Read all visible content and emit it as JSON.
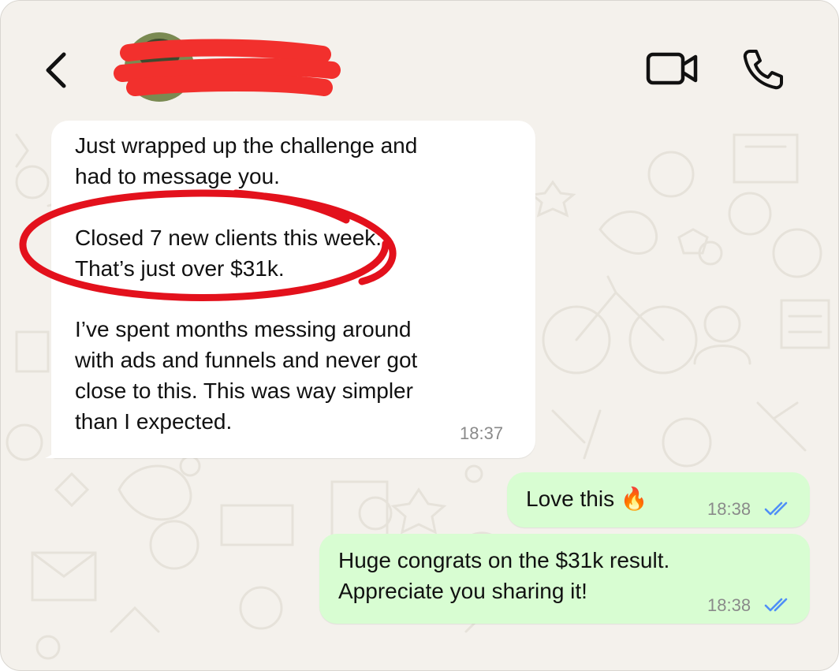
{
  "header": {
    "contact_name": "",
    "icons": {
      "back": "chevron-left-icon",
      "video": "video-camera-icon",
      "call": "phone-icon"
    }
  },
  "messages": {
    "incoming": {
      "p1": "Just wrapped up the challenge and\nhad to message you.",
      "p2": "Closed 7 new clients this week.\nThat’s just over $31k.",
      "p3": "I’ve spent months messing around\nwith ads and funnels and never got\nclose to this. This was way simpler\nthan I expected.",
      "time": "18:37"
    },
    "outgoing": [
      {
        "text": "Love this 🔥",
        "time": "18:38",
        "status": "read"
      },
      {
        "text": "Huge congrats on the $31k result.\nAppreciate you sharing it!",
        "time": "18:38",
        "status": "read"
      }
    ]
  },
  "colors": {
    "chat_background": "#f4f1ec",
    "incoming_bubble": "#ffffff",
    "outgoing_bubble": "#d8fdd2",
    "read_ticks": "#4f8ff7",
    "annotation_red": "#e3111c"
  }
}
